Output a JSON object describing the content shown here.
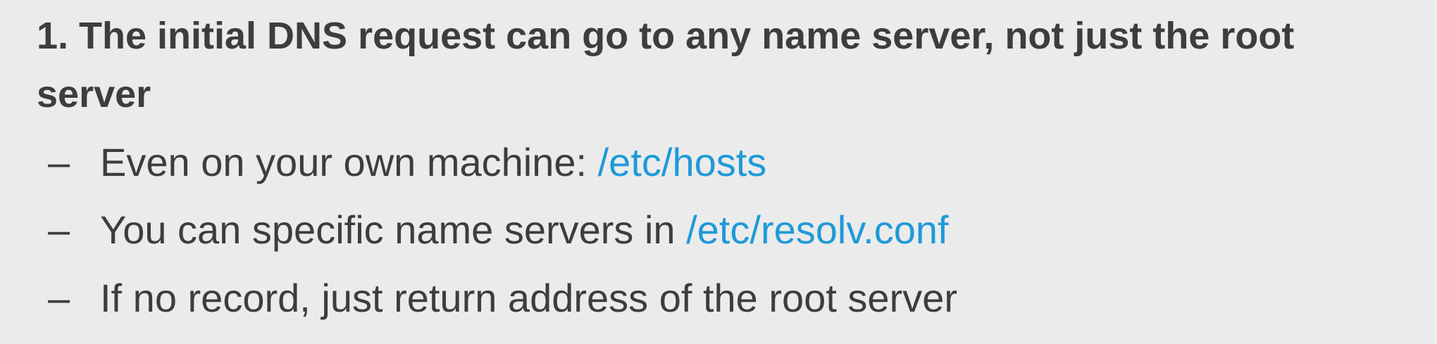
{
  "heading": "1. The initial DNS request can go to any name server, not just the root server",
  "bullets": [
    {
      "marker": "–",
      "text": "Even on your own machine: ",
      "path": "/etc/hosts"
    },
    {
      "marker": "–",
      "text": "You can specific name servers in ",
      "path": "/etc/resolv.conf"
    },
    {
      "marker": "–",
      "text": "If no record, just return address of the root server",
      "path": ""
    }
  ],
  "colors": {
    "background": "#ebebeb",
    "text": "#3d3d3d",
    "path_highlight": "#1e9ad8"
  }
}
